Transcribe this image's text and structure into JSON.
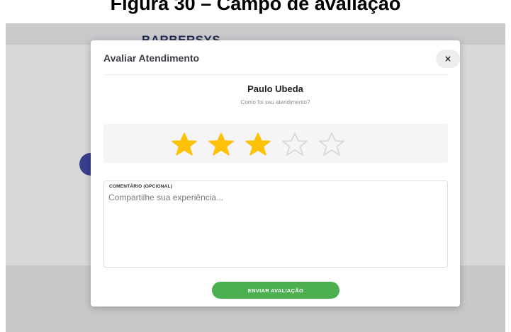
{
  "caption": "Figura 30 – Campo de avaliação",
  "background": {
    "logo_text": "BARBERSYS"
  },
  "modal": {
    "title": "Avaliar Atendimento",
    "close_label": "×",
    "person_name": "Paulo Ubeda",
    "question": "Como foi seu atendimento?",
    "rating": {
      "value": 3,
      "max": 5,
      "filled_color": "#FFC107",
      "empty_color": "#D9D9DC"
    },
    "comment": {
      "label": "COMENTÁRIO (OPCIONAL)",
      "placeholder": "Compartilhe sua experiência...",
      "value": ""
    },
    "submit_label": "ENVIAR AVALIAÇÃO",
    "submit_color": "#4CAF50"
  }
}
